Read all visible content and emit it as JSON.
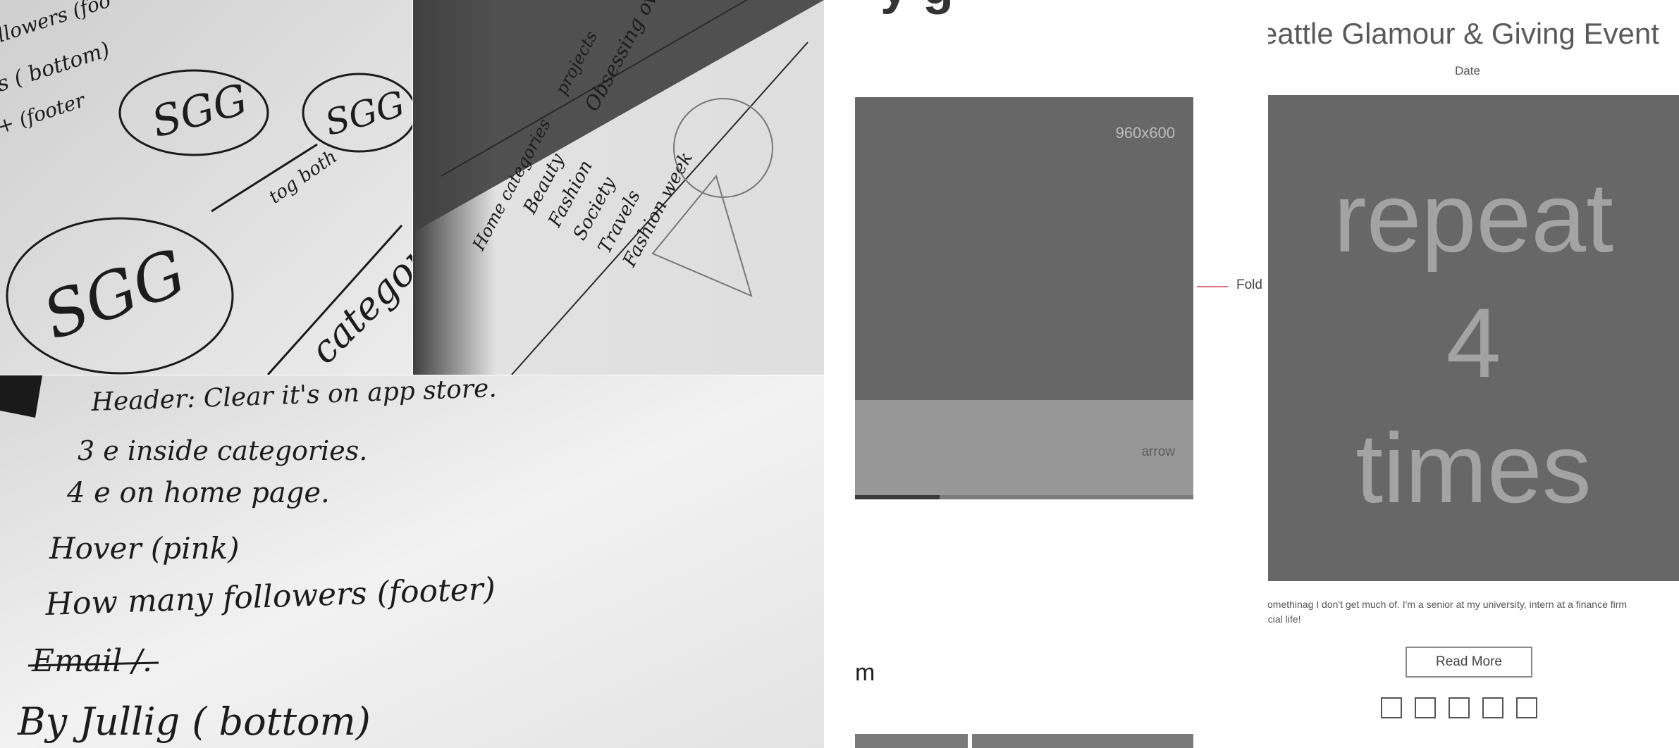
{
  "sketch_notes": {
    "photo1": {
      "logo_text": "SGG",
      "arrow_note": "tog both",
      "side_notes": [
        "llowers (foo",
        "s ( bottom)",
        "+ (footer"
      ],
      "categories_word": "categori"
    },
    "photo2": {
      "nav_items": [
        "Home",
        "categories",
        "projects"
      ],
      "category_list": [
        "Beauty",
        "Fashion",
        "Society",
        "Travels",
        "Fashion week"
      ],
      "side_note": "Obsessing over"
    },
    "photo3": {
      "lines": [
        "Header: Clear it's on app store.",
        "3 e inside categories.",
        "4 e on home page.",
        "Hover (pink)",
        "How many followers (footer)",
        "Email /.",
        "By Jullig ( bottom)"
      ]
    }
  },
  "middle_wireframe": {
    "partial_heading": "y g",
    "hero_size_label": "960x600",
    "arrow_label": "arrow",
    "fold_label": "Fold",
    "partial_text": "m",
    "colors": {
      "hero": "#676767",
      "strip": "#979797",
      "fold": "#e07080"
    }
  },
  "right_wireframe": {
    "title": "eattle Glamour & Giving Event",
    "date_label": "Date",
    "repeat_lines": [
      "repeat",
      "4",
      "times"
    ],
    "description_line1": "somethinag I don't get much of. I'm a senior at my university, intern at a finance firm",
    "description_line2": "ocial life!",
    "read_more_label": "Read More",
    "social_icon_count": 5
  }
}
